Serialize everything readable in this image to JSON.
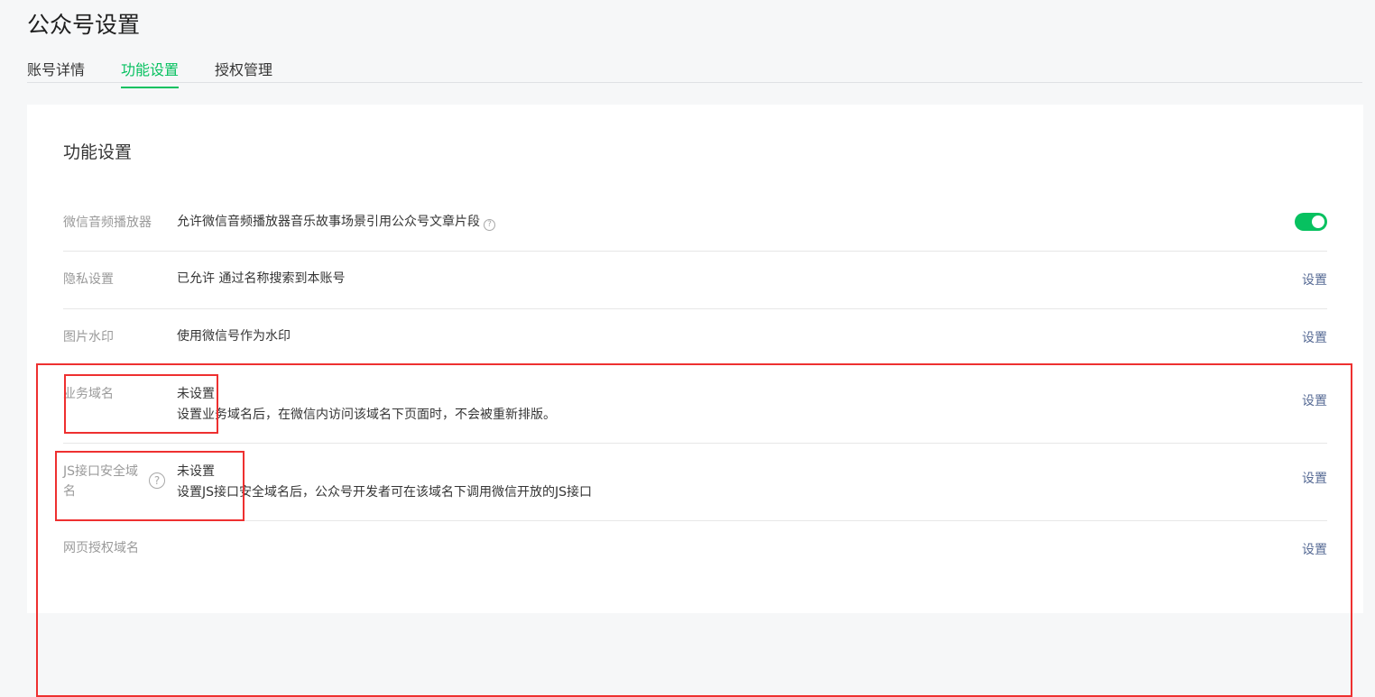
{
  "page": {
    "title": "公众号设置"
  },
  "tabs": [
    {
      "label": "账号详情",
      "active": false
    },
    {
      "label": "功能设置",
      "active": true
    },
    {
      "label": "授权管理",
      "active": false
    }
  ],
  "card": {
    "title": "功能设置",
    "rows": [
      {
        "label": "微信音频播放器",
        "content": "允许微信音频播放器音乐故事场景引用公众号文章片段",
        "help_icon": "question-circle-icon",
        "toggle_on": true
      },
      {
        "label": "隐私设置",
        "content": "已允许 通过名称搜索到本账号",
        "action": "设置"
      },
      {
        "label": "图片水印",
        "content": "使用微信号作为水印",
        "action": "设置"
      },
      {
        "label": "业务域名",
        "status": "未设置",
        "desc": "设置业务域名后，在微信内访问该域名下页面时，不会被重新排版。",
        "action": "设置"
      },
      {
        "label": "JS接口安全域名",
        "help_icon": "question-circle-icon",
        "status": "未设置",
        "desc": "设置JS接口安全域名后，公众号开发者可在该域名下调用微信开放的JS接口",
        "action": "设置"
      },
      {
        "label": "网页授权域名",
        "action": "设置"
      }
    ]
  },
  "colors": {
    "accent": "#07c160",
    "link": "#576b95",
    "annotation": "#ee3030"
  }
}
